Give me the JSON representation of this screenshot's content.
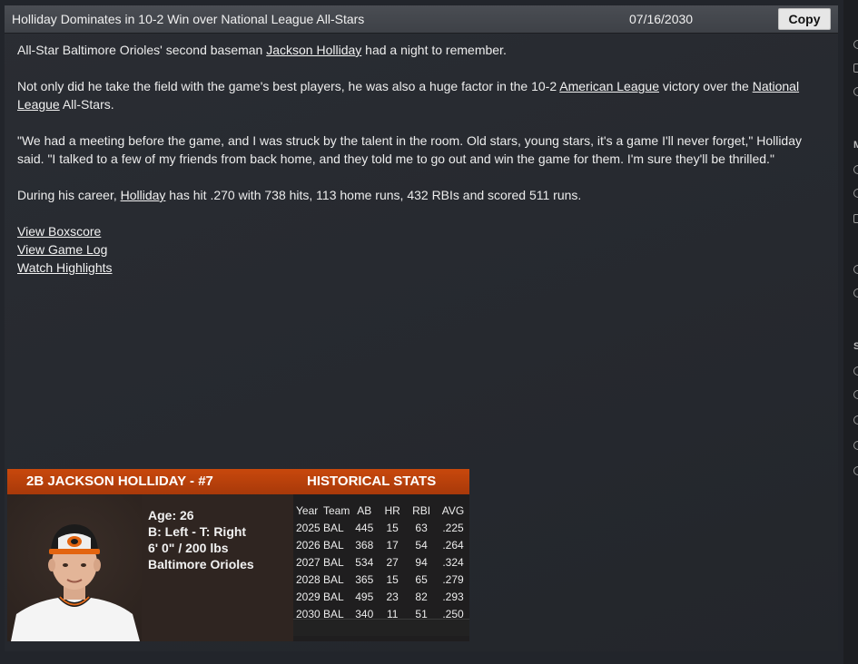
{
  "article": {
    "headline": "Holliday Dominates in 10-2 Win over National League All-Stars",
    "date": "07/16/2030",
    "copy_label": "Copy",
    "p1": {
      "before": "All-Star Baltimore Orioles' second baseman ",
      "link": "Jackson Holliday",
      "after": " had a night to remember."
    },
    "p2": {
      "before": "Not only did he take the field with the game's best players, he was also a huge factor in the 10-2 ",
      "link1": "American League",
      "middle": " victory over the ",
      "link2": "National League",
      "after": " All-Stars."
    },
    "p3": "\"We had a meeting before the game, and I was struck by the talent in the room. Old stars, young stars, it's a game I'll never forget,\" Holliday said. \"I talked to a few of my friends from back home, and they told me to go out and win the game for them. I'm sure they'll be thrilled.\"",
    "p4": {
      "before": "During his career, ",
      "link": "Holliday",
      "after": " has hit .270 with 738 hits, 113 home runs, 432 RBIs and scored 511 runs."
    },
    "links": [
      "View Boxscore",
      "View Game Log",
      "Watch Highlights"
    ]
  },
  "card": {
    "player_title": "2B JACKSON HOLLIDAY - #7",
    "stats_title": "HISTORICAL STATS",
    "bio": {
      "age": "Age: 26",
      "bats_throws": "B: Left - T: Right",
      "size": "6' 0\"  / 200 lbs",
      "team": "Baltimore Orioles"
    },
    "table": {
      "headers": [
        "Year",
        "Team",
        "AB",
        "HR",
        "RBI",
        "AVG"
      ],
      "rows": [
        [
          "2025",
          "BAL",
          "445",
          "15",
          "63",
          ".225"
        ],
        [
          "2026",
          "BAL",
          "368",
          "17",
          "54",
          ".264"
        ],
        [
          "2027",
          "BAL",
          "534",
          "27",
          "94",
          ".324"
        ],
        [
          "2028",
          "BAL",
          "365",
          "15",
          "65",
          ".279"
        ],
        [
          "2029",
          "BAL",
          "495",
          "23",
          "82",
          ".293"
        ],
        [
          "2030",
          "BAL",
          "340",
          "11",
          "51",
          ".250"
        ]
      ]
    }
  },
  "sidebar_fragments": {
    "letters": [
      "M",
      "S"
    ]
  },
  "colors": {
    "accent": "#b8410b",
    "background": "#22252b",
    "titlebar": "#44474d"
  }
}
